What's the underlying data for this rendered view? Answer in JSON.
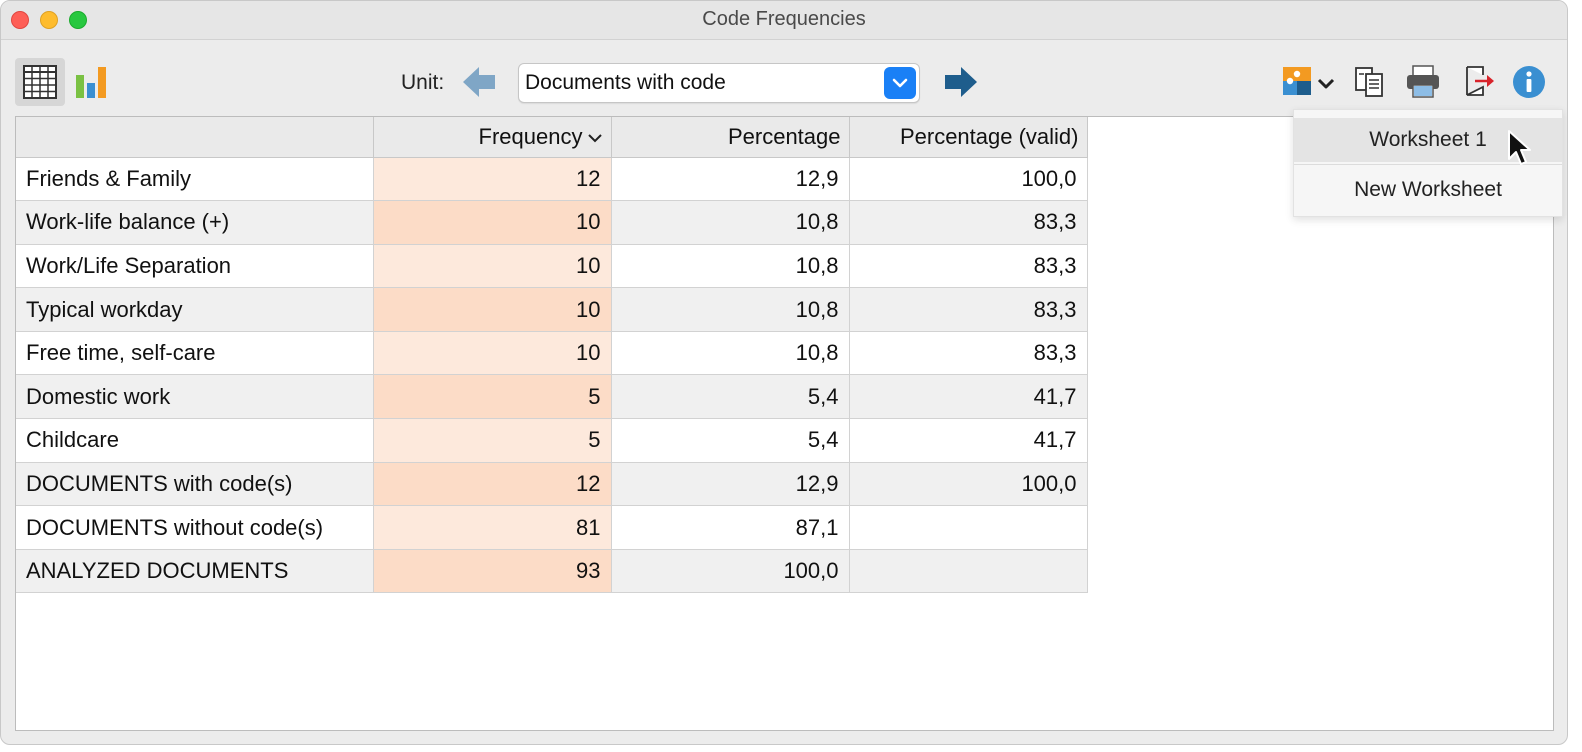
{
  "window": {
    "title": "Code Frequencies"
  },
  "toolbar": {
    "unit_label": "Unit:",
    "unit_value": "Documents with code"
  },
  "table": {
    "columns": [
      "",
      "Frequency",
      "Percentage",
      "Percentage (valid)"
    ],
    "rows": [
      {
        "name": "Friends & Family",
        "frequency": "12",
        "percentage": "12,9",
        "valid": "100,0"
      },
      {
        "name": "Work-life balance (+)",
        "frequency": "10",
        "percentage": "10,8",
        "valid": "83,3"
      },
      {
        "name": "Work/Life Separation",
        "frequency": "10",
        "percentage": "10,8",
        "valid": "83,3"
      },
      {
        "name": "Typical workday",
        "frequency": "10",
        "percentage": "10,8",
        "valid": "83,3"
      },
      {
        "name": "Free time, self-care",
        "frequency": "10",
        "percentage": "10,8",
        "valid": "83,3"
      },
      {
        "name": "Domestic work",
        "frequency": "5",
        "percentage": "5,4",
        "valid": "41,7"
      },
      {
        "name": "Childcare",
        "frequency": "5",
        "percentage": "5,4",
        "valid": "41,7"
      },
      {
        "name": "DOCUMENTS with code(s)",
        "frequency": "12",
        "percentage": "12,9",
        "valid": "100,0"
      },
      {
        "name": "DOCUMENTS without code(s)",
        "frequency": "81",
        "percentage": "87,1",
        "valid": ""
      },
      {
        "name": "ANALYZED DOCUMENTS",
        "frequency": "93",
        "percentage": "100,0",
        "valid": ""
      }
    ]
  },
  "menu": {
    "items": [
      "Worksheet 1",
      "New Worksheet"
    ]
  },
  "colors": {
    "accent": "#1a80f6",
    "frequency_cell": "#fde9dc",
    "close": "#fe5f57",
    "minimize": "#febc2e",
    "maximize": "#28c840"
  }
}
